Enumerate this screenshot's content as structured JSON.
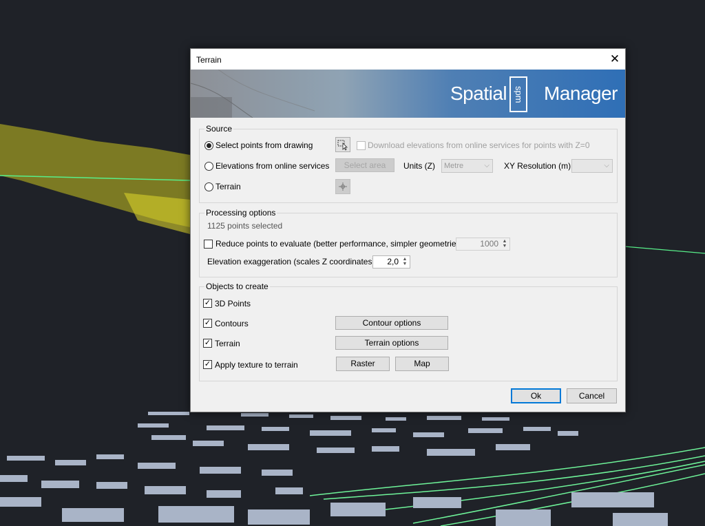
{
  "dialog": {
    "title": "Terrain",
    "close_glyph": "✕"
  },
  "banner": {
    "brand_left": "Spatial",
    "brand_mark": "spm",
    "brand_right": "Manager"
  },
  "source": {
    "legend": "Source",
    "options": [
      {
        "label": "Select points from drawing",
        "selected": true
      },
      {
        "label": "Elevations from online services",
        "selected": false
      },
      {
        "label": "Terrain",
        "selected": false
      }
    ],
    "download_label": "Download elevations from online services for points with Z=0",
    "select_area_label": "Select area",
    "units_label": "Units (Z)",
    "units_value": "Metre",
    "xy_resolution_label": "XY Resolution (m)",
    "xy_resolution_value": "",
    "icons": {
      "select_points": "cursor-select-icon",
      "terrain_pick": "crosshair-icon"
    }
  },
  "processing": {
    "legend": "Processing options",
    "points_selected": "1125 points selected",
    "reduce_label": "Reduce points to evaluate (better performance, simpler geometries)",
    "reduce_value": "1000",
    "exaggeration_label": "Elevation exaggeration (scales Z coordinates)",
    "exaggeration_value": "2,0"
  },
  "objects": {
    "legend": "Objects to create",
    "points_label": "3D Points",
    "contours_label": "Contours",
    "contour_options_label": "Contour options",
    "terrain_label": "Terrain",
    "terrain_options_label": "Terrain options",
    "texture_label": "Apply texture to terrain",
    "raster_label": "Raster",
    "map_label": "Map"
  },
  "footer": {
    "ok_label": "Ok",
    "cancel_label": "Cancel"
  },
  "colors": {
    "accent": "#0078d7",
    "banner_blue": "#2f6fb6",
    "viewport_bg": "#1f2228"
  }
}
